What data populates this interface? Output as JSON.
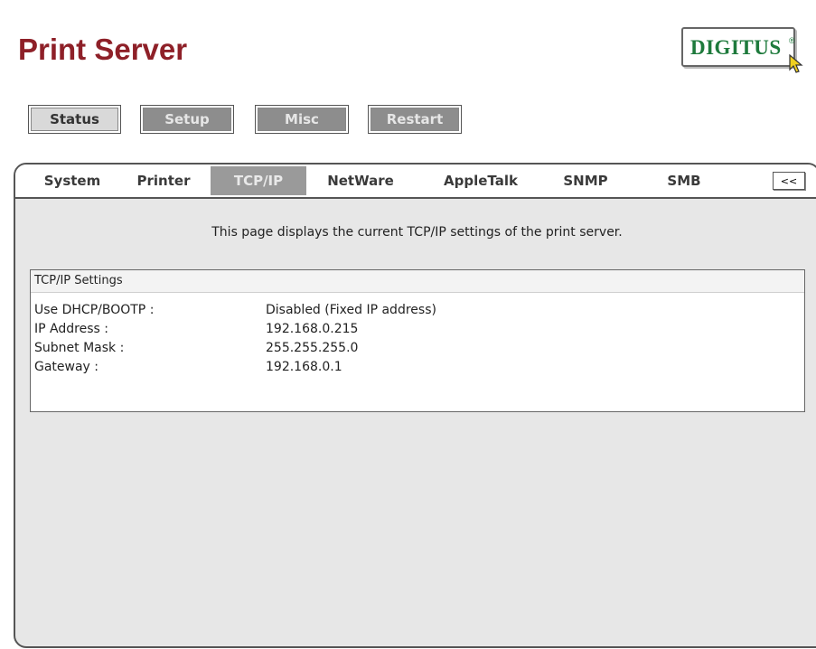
{
  "header": {
    "title": "Print Server",
    "logo_text": "DIGITUS",
    "logo_reg": "®"
  },
  "nav": {
    "buttons": [
      {
        "label": "Status"
      },
      {
        "label": "Setup"
      },
      {
        "label": "Misc"
      },
      {
        "label": "Restart"
      }
    ]
  },
  "tabs": {
    "items": [
      {
        "label": "System"
      },
      {
        "label": "Printer"
      },
      {
        "label": "TCP/IP"
      },
      {
        "label": "NetWare"
      },
      {
        "label": "AppleTalk"
      },
      {
        "label": "SNMP"
      },
      {
        "label": "SMB"
      }
    ],
    "active": "TCP/IP",
    "collapse_label": "<<"
  },
  "content": {
    "description": "This page displays the current TCP/IP settings of the print server.",
    "section_title": "TCP/IP Settings",
    "rows": [
      {
        "label": "Use DHCP/BOOTP :",
        "value": "Disabled (Fixed IP address)"
      },
      {
        "label": "IP Address :",
        "value": "192.168.0.215"
      },
      {
        "label": "Subnet Mask :",
        "value": "255.255.255.0"
      },
      {
        "label": "Gateway :",
        "value": "192.168.0.1"
      }
    ]
  },
  "colors": {
    "title": "#8e2028",
    "logo": "#1e7a3c",
    "panel_bg": "#e7e7e7",
    "active_tab": "#9a9a9a"
  }
}
